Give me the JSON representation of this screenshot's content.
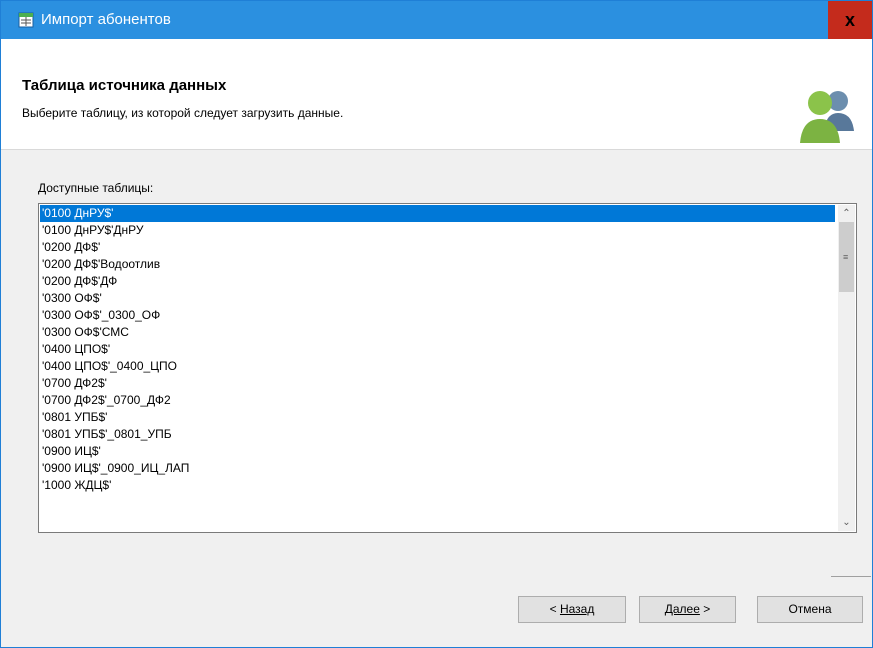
{
  "window": {
    "title": "Импорт абонентов",
    "close_label": "x",
    "title_bar_color": "#2b90e0",
    "close_color": "#c42b1c"
  },
  "header": {
    "title": "Таблица источника данных",
    "subtitle": "Выберите таблицу, из которой следует загрузить данные.",
    "icon": "users-icon"
  },
  "tables": {
    "label": "Доступные таблицы:",
    "selected_index": 0,
    "items": [
      "'0100 ДнРУ$'",
      "'0100 ДнРУ$'ДнРУ",
      "'0200 ДФ$'",
      "'0200 ДФ$'Водоотлив",
      "'0200 ДФ$'ДФ",
      "'0300 ОФ$'",
      "'0300 ОФ$'_0300_ОФ",
      "'0300 ОФ$'СМС",
      "'0400 ЦПО$'",
      "'0400 ЦПО$'_0400_ЦПО",
      "'0700 ДФ2$'",
      "'0700 ДФ2$'_0700_ДФ2",
      "'0801 УПБ$'",
      "'0801 УПБ$'_0801_УПБ",
      "'0900 ИЦ$'",
      "'0900 ИЦ$'_0900_ИЦ_ЛАП",
      "'1000 ЖДЦ$'"
    ]
  },
  "buttons": {
    "back_prefix": "< ",
    "back_label": "Назад",
    "next_label": "Далее",
    "next_suffix": " >",
    "cancel_label": "Отмена"
  }
}
